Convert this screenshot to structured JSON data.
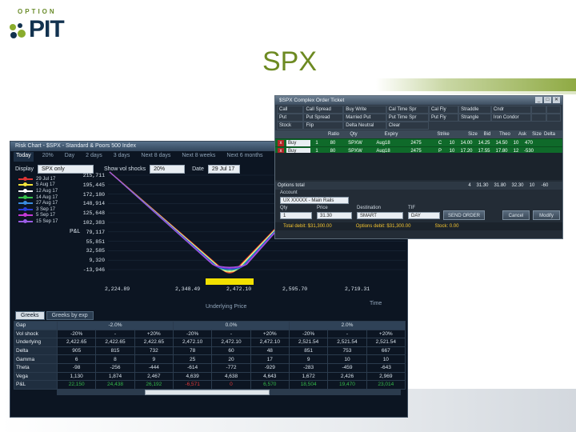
{
  "slide": {
    "title": "SPX",
    "logo": {
      "tagline": "OPTION",
      "word": "PIT"
    }
  },
  "risk_chart": {
    "window_title": "Risk Chart - $SPX - Standard & Poors 500 Index",
    "periods": [
      {
        "label": "Today",
        "active": true
      },
      {
        "label": "20%",
        "active": false
      },
      {
        "label": "Day",
        "active": false
      },
      {
        "label": "2 days",
        "active": false
      },
      {
        "label": "3 days",
        "active": false
      },
      {
        "label": "Next 8 days",
        "active": false
      },
      {
        "label": "Next 8 weeks",
        "active": false
      },
      {
        "label": "Next 6 months",
        "active": false
      }
    ],
    "display_label": "Display",
    "display_value": "SPX only",
    "show_vol_shocks_label": "Show vol shocks",
    "vol_shock_value": "20%",
    "date_label": "Date",
    "date_value": "29 Jul 17",
    "legend": [
      {
        "label": "29 Jul 17",
        "color": "#e03535"
      },
      {
        "label": "5 Aug 17",
        "color": "#f2e33a"
      },
      {
        "label": "12 Aug 17",
        "color": "#ffffff"
      },
      {
        "label": "14 Aug 17",
        "color": "#37c24b"
      },
      {
        "label": "27 Aug 17",
        "color": "#3a8de0"
      },
      {
        "label": "3 Sep 17",
        "color": "#2a3fd6"
      },
      {
        "label": "5 Sep 17",
        "color": "#c43ad6"
      },
      {
        "label": "15 Sep 17",
        "color": "#9b5de5"
      }
    ],
    "pl_label": "P&L",
    "y_ticks": [
      "215,711",
      "195,445",
      "172,180",
      "148,914",
      "125,648",
      "102,383",
      "79,117",
      "55,851",
      "32,585",
      "9,320",
      "-13,946"
    ],
    "x_ticks": [
      "2,224.89",
      "2,348.49",
      "2,472.10",
      "2,595.70",
      "2,719.31"
    ],
    "underlying_label": "Underlying Price",
    "time_label": "Time",
    "tabs": [
      {
        "label": "Greeks",
        "active": true
      },
      {
        "label": "Greeks by exp",
        "active": false
      }
    ],
    "greeks": {
      "gap": [
        "Gap",
        "-2.0%",
        "0.0%",
        "2.0%"
      ],
      "rows": [
        {
          "label": "Vol shock",
          "cells": [
            "-20%",
            "-",
            "+20%",
            "-20%",
            "-",
            "+20%",
            "-20%",
            "-",
            "+20%"
          ]
        },
        {
          "label": "Underlying",
          "cells": [
            "2,422.65",
            "2,422.65",
            "2,422.65",
            "2,472.10",
            "2,472.10",
            "2,472.10",
            "2,521.54",
            "2,521.54",
            "2,521.54"
          ]
        },
        {
          "label": "Delta",
          "cells": [
            "905",
            "815",
            "732",
            "78",
            "60",
            "48",
            "851",
            "753",
            "667"
          ]
        },
        {
          "label": "Gamma",
          "cells": [
            "6",
            "8",
            "9",
            "25",
            "20",
            "17",
            "9",
            "10",
            "10"
          ]
        },
        {
          "label": "Theta",
          "cells": [
            "-98",
            "-256",
            "-444",
            "-614",
            "-772",
            "-929",
            "-283",
            "-459",
            "-643"
          ]
        },
        {
          "label": "Vega",
          "cells": [
            "1,130",
            "1,874",
            "2,467",
            "4,639",
            "4,638",
            "4,643",
            "1,672",
            "2,426",
            "2,969"
          ]
        },
        {
          "label": "P&L",
          "cells": [
            "22,150",
            "24,438",
            "26,192",
            "-6,571",
            "0",
            "6,570",
            "18,504",
            "19,470",
            "23,014"
          ]
        }
      ]
    }
  },
  "ticket": {
    "window_title": "$SPX Complex Order Ticket",
    "strategies": [
      "Call",
      "Call Spread",
      "Buy Write",
      "Cal Time Spr",
      "Cal Fly",
      "Straddle",
      "Cndr",
      "",
      "",
      "Put",
      "Put Spread",
      "Married Put",
      "Put Time Spr",
      "Put Fly",
      "Strangle",
      "Iron Condor",
      "",
      "",
      "Stock",
      "Flip",
      "Delta Neutral",
      "Clear"
    ],
    "leg_headers": [
      "Ratio",
      "Qty",
      "Expiry",
      "Strike",
      "Size",
      "Bid",
      "Theo",
      "Ask",
      "Size",
      "Delta"
    ],
    "legs": [
      {
        "x": "x",
        "action": "Buy",
        "ratio": "1",
        "qty": "80",
        "root": "SPXW",
        "expiry": "Aug18",
        "strike": "2475",
        "type": "C",
        "size": "10",
        "bid": "14.00",
        "theo": "14.25",
        "ask": "14.50",
        "size2": "10",
        "delta": "470"
      },
      {
        "x": "x",
        "action": "Buy",
        "ratio": "1",
        "qty": "80",
        "root": "SPXW",
        "expiry": "Aug18",
        "strike": "2475",
        "type": "P",
        "size": "10",
        "bid": "17.20",
        "theo": "17.55",
        "ask": "17.80",
        "size2": "12",
        "delta": "-530"
      }
    ],
    "options_total": {
      "label": "Options total",
      "size": "4",
      "bid": "31.30",
      "theo": "31.80",
      "ask": "32.30",
      "size2": "10",
      "delta": "-60"
    },
    "account_label": "Account",
    "account_value": "UX XXXXX - Main Rails",
    "qty_label": "Qty",
    "qty_value": "1",
    "price_label": "Price",
    "price_value": "31.30",
    "destination_label": "Destination",
    "destination_value": "SMART",
    "tif_label": "TIF",
    "tif_value": "DAY",
    "send_button": "SEND ORDER",
    "cancel_button": "Cancel",
    "modify_button": "Modify",
    "status": [
      "Total debit: $31,300.00",
      "Options debit: $31,300.00",
      "Stock: 0.00"
    ]
  }
}
